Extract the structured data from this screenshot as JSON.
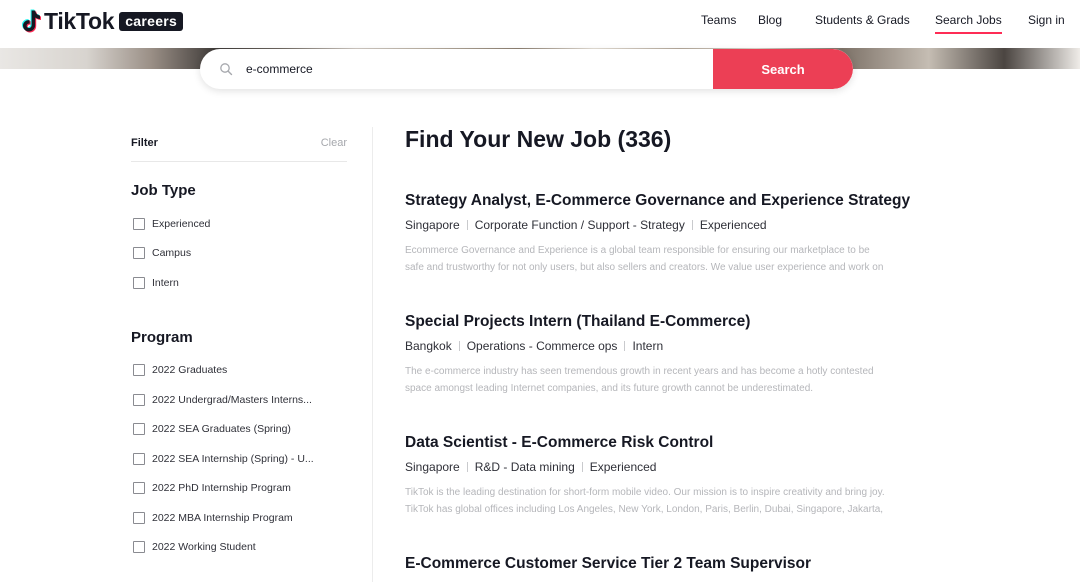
{
  "header": {
    "brand": "TikTok",
    "badge": "careers",
    "nav": [
      {
        "label": "Teams"
      },
      {
        "label": "Blog"
      },
      {
        "label": "Students & Grads"
      },
      {
        "label": "Search Jobs"
      },
      {
        "label": "Sign in"
      }
    ]
  },
  "search": {
    "value": "e-commerce",
    "button_label": "Search"
  },
  "sidebar": {
    "filter_label": "Filter",
    "clear_label": "Clear",
    "job_type": {
      "title": "Job Type",
      "options": [
        "Experienced",
        "Campus",
        "Intern"
      ]
    },
    "program": {
      "title": "Program",
      "options": [
        "2022 Graduates",
        "2022 Undergrad/Masters Interns...",
        "2022 SEA Graduates (Spring)",
        "2022 SEA Internship (Spring) - U...",
        "2022 PhD Internship Program",
        "2022 MBA Internship Program",
        "2022 Working Student"
      ]
    }
  },
  "main": {
    "title": "Find Your New Job (336)",
    "jobs": [
      {
        "title": "Strategy Analyst, E-Commerce Governance and Experience Strategy",
        "location": "Singapore",
        "category": "Corporate Function / Support - Strategy",
        "type": "Experienced",
        "desc1": "Ecommerce Governance and Experience is a global team responsible for ensuring our marketplace to be",
        "desc2": "safe and trustworthy for not only users, but also sellers and creators. We value user experience and work on"
      },
      {
        "title": "Special Projects Intern (Thailand E-Commerce)",
        "location": "Bangkok",
        "category": "Operations - Commerce ops",
        "type": "Intern",
        "desc1": "The e-commerce industry has seen tremendous growth in recent years and has become a hotly contested",
        "desc2": "space amongst leading Internet companies, and its future growth cannot be underestimated."
      },
      {
        "title": "Data Scientist - E-Commerce Risk Control",
        "location": "Singapore",
        "category": "R&D - Data mining",
        "type": "Experienced",
        "desc1": "TikTok is the leading destination for short-form mobile video. Our mission is to inspire creativity and bring joy.",
        "desc2": "TikTok has global offices including Los Angeles, New York, London, Paris, Berlin, Dubai, Singapore, Jakarta,"
      },
      {
        "title": "E-Commerce Customer Service Tier 2 Team Supervisor"
      }
    ]
  },
  "colors": {
    "accent": "#ec3f55",
    "nav_underline": "#fe2c55",
    "text": "#161823",
    "muted": "#b5b6ba"
  },
  "icons": {
    "logo": "tiktok-note-icon",
    "search": "search-icon",
    "checkbox": "checkbox-empty"
  }
}
